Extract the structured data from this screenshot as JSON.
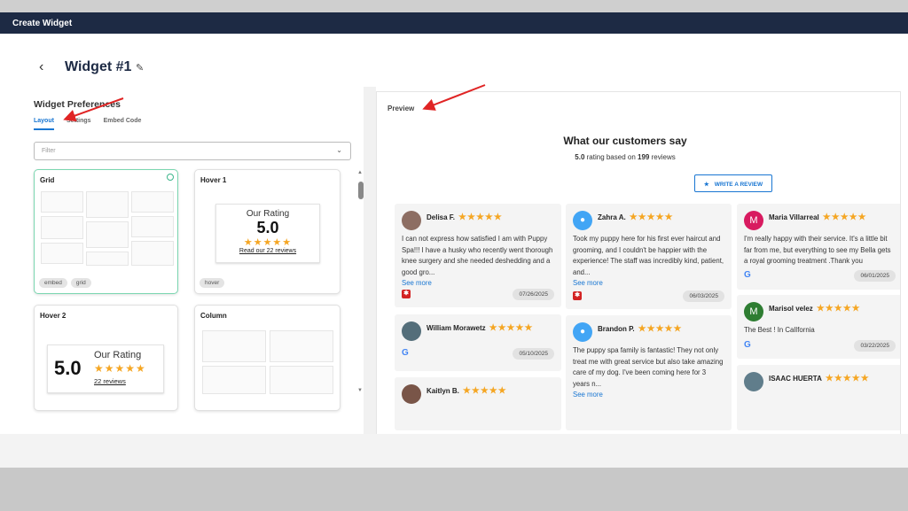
{
  "app": {
    "title": "Create Widget"
  },
  "header": {
    "widget_name": "Widget #1",
    "back_glyph": "‹",
    "edit_glyph": "✎"
  },
  "prefs": {
    "title": "Widget Preferences",
    "tabs": [
      {
        "label": "Layout",
        "active": true
      },
      {
        "label": "Settings"
      },
      {
        "label": "Embed Code"
      }
    ],
    "filter_placeholder": "Filter",
    "layouts": [
      {
        "title": "Grid",
        "tags": [
          "embed",
          "grid"
        ],
        "selected": true
      },
      {
        "title": "Hover 1",
        "rating_label": "Our Rating",
        "rating": "5.0",
        "stars": "★★★★★",
        "link": "Read our 22 reviews",
        "tags": [
          "hover"
        ]
      },
      {
        "title": "Hover 2",
        "rating": "5.0",
        "rating_label": "Our Rating",
        "stars": "★★★★★",
        "link": "22 reviews"
      },
      {
        "title": "Column"
      }
    ]
  },
  "preview": {
    "label": "Preview",
    "heading": "What our customers say",
    "rating_value": "5.0",
    "rating_mid": "rating based on",
    "review_count": "199",
    "rating_tail": "reviews",
    "write_button": "WRITE A REVIEW",
    "write_icon": "★",
    "see_more": "See more",
    "reviews": [
      {
        "name": "Delisa F.",
        "stars": "★★★★★",
        "text": "I can not express how satisfied I am with Puppy Spa!!! I have a husky who recently went thorough knee surgery and she needed deshedding and a good gro...",
        "date": "07/26/2025",
        "source": "yelp",
        "color": "#8d6e63",
        "initial": ""
      },
      {
        "name": "William Morawetz",
        "stars": "★★★★★",
        "date": "05/10/2025",
        "source": "google",
        "color": "#546e7a",
        "initial": ""
      },
      {
        "name": "Kaitlyn B.",
        "stars": "★★★★★",
        "color": "#795548",
        "initial": ""
      },
      {
        "name": "Zahra A.",
        "stars": "★★★★★",
        "text": "Took my puppy here for his first ever haircut and grooming, and I couldn't be happier with the experience! The staff was incredibly kind, patient, and...",
        "date": "06/03/2025",
        "source": "yelp",
        "color": "#42a5f5",
        "initial": "👤"
      },
      {
        "name": "Brandon P.",
        "stars": "★★★★★",
        "text": "The puppy spa family is fantastic! They not only treat me with great service but also take amazing care of my dog. I've been coming here for 3 years n...",
        "color": "#42a5f5",
        "initial": "👤"
      },
      {
        "name": "Maria Villarreal",
        "stars": "★★★★★",
        "text": "I'm really happy with their service. It's a little bit far from me, but everything to see my Bella gets a royal grooming treatment .Thank you",
        "date": "06/01/2025",
        "source": "google",
        "color": "#d81b60",
        "initial": "M"
      },
      {
        "name": "Marisol velez",
        "stars": "★★★★★",
        "text": "The Best ! In CalIfornia",
        "date": "03/22/2025",
        "source": "google",
        "color": "#2e7d32",
        "initial": "M"
      },
      {
        "name": "ISAAC HUERTA",
        "stars": "★★★★★",
        "color": "#607d8b",
        "initial": ""
      }
    ]
  },
  "colors": {
    "topbar": "#1d2a44",
    "accent": "#1976d2",
    "star": "#f5a623",
    "arrow": "#e02424"
  }
}
